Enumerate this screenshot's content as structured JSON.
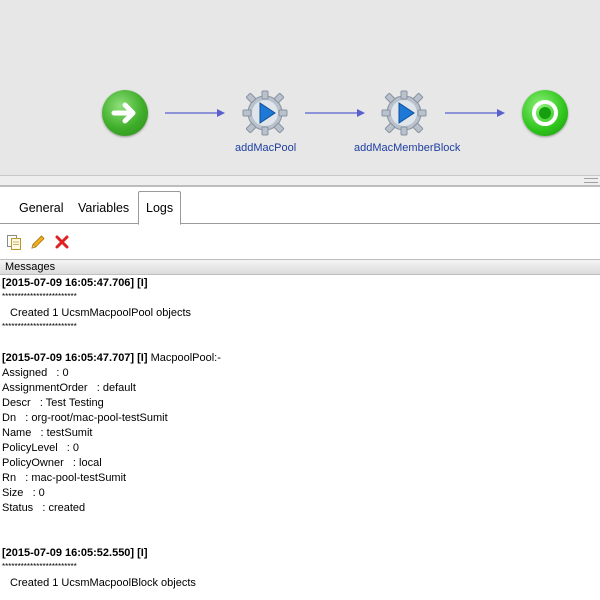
{
  "workflow": {
    "nodes": [
      {
        "label": "addMacPool"
      },
      {
        "label": "addMacMemberBlock"
      }
    ]
  },
  "tabs": {
    "general": "General",
    "variables": "Variables",
    "logs": "Logs"
  },
  "toolbar": {
    "icons": [
      "copy-icon",
      "edit-icon",
      "delete-icon"
    ]
  },
  "messages_header": "Messages",
  "log_lines": {
    "l01": "[2015-07-09 16:05:47.706] [I]",
    "l02": "************************",
    "l03": " Created 1 UcsmMacpoolPool objects",
    "l04": "************************",
    "l06_stamp": "[2015-07-09 16:05:47.707] [I]",
    "l06_rest": " MacpoolPool:-",
    "l07": "Assigned   : 0",
    "l08": "AssignmentOrder   : default",
    "l09": "Descr   : Test Testing",
    "l10": "Dn   : org-root/mac-pool-testSumit",
    "l11": "Name   : testSumit",
    "l12": "PolicyLevel   : 0",
    "l13": "PolicyOwner   : local",
    "l14": "Rn   : mac-pool-testSumit",
    "l15": "Size   : 0",
    "l16": "Status   : created",
    "l19": "[2015-07-09 16:05:52.550] [I]",
    "l20": "************************",
    "l21": " Created 1 UcsmMacpoolBlock objects"
  },
  "colors": {
    "canvas_bg": "#e7e7e7",
    "connector": "#5a5fd0",
    "node_label": "#1f3fa0",
    "delete_red": "#e02020"
  }
}
